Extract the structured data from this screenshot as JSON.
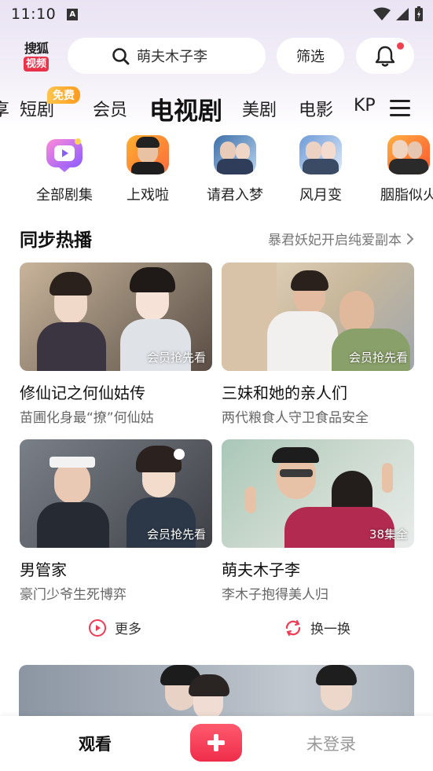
{
  "status_bar": {
    "time": "11:10",
    "notif_glyph": "A"
  },
  "header": {
    "logo_top": "搜狐",
    "logo_bottom": "视频",
    "search_placeholder": "萌夫木子李",
    "filter_label": "筛选"
  },
  "tabs": [
    {
      "label": "享"
    },
    {
      "label": "短剧",
      "badge": "免费"
    },
    {
      "label": "会员"
    },
    {
      "label": "电视剧",
      "active": true
    },
    {
      "label": "美剧"
    },
    {
      "label": "电影"
    },
    {
      "label": "KP"
    }
  ],
  "categories": [
    {
      "label": "全部剧集",
      "icon": "play-tv-icon"
    },
    {
      "label": "上戏啦"
    },
    {
      "label": "请君入梦"
    },
    {
      "label": "风月变"
    },
    {
      "label": "胭脂似火"
    }
  ],
  "section": {
    "title": "同步热播",
    "link": "暴君妖妃开启纯爱副本"
  },
  "cards": [
    {
      "title": "修仙记之何仙姑传",
      "subtitle": "苗圃化身最“撩”何仙姑",
      "tag": "会员抢先看"
    },
    {
      "title": "三妹和她的亲人们",
      "subtitle": "两代粮食人守卫食品安全",
      "tag": "会员抢先看"
    },
    {
      "title": "男管家",
      "subtitle": "豪门少爷生死博弈",
      "tag": "会员抢先看"
    },
    {
      "title": "萌夫木子李",
      "subtitle": "李木子抱得美人归",
      "tag": "38集全"
    }
  ],
  "actions": {
    "more": "更多",
    "refresh": "换一换"
  },
  "bottom_nav": {
    "watch": "观看",
    "login": "未登录"
  },
  "colors": {
    "accent": "#ef2d4b",
    "badge": "#ff9a1f"
  }
}
